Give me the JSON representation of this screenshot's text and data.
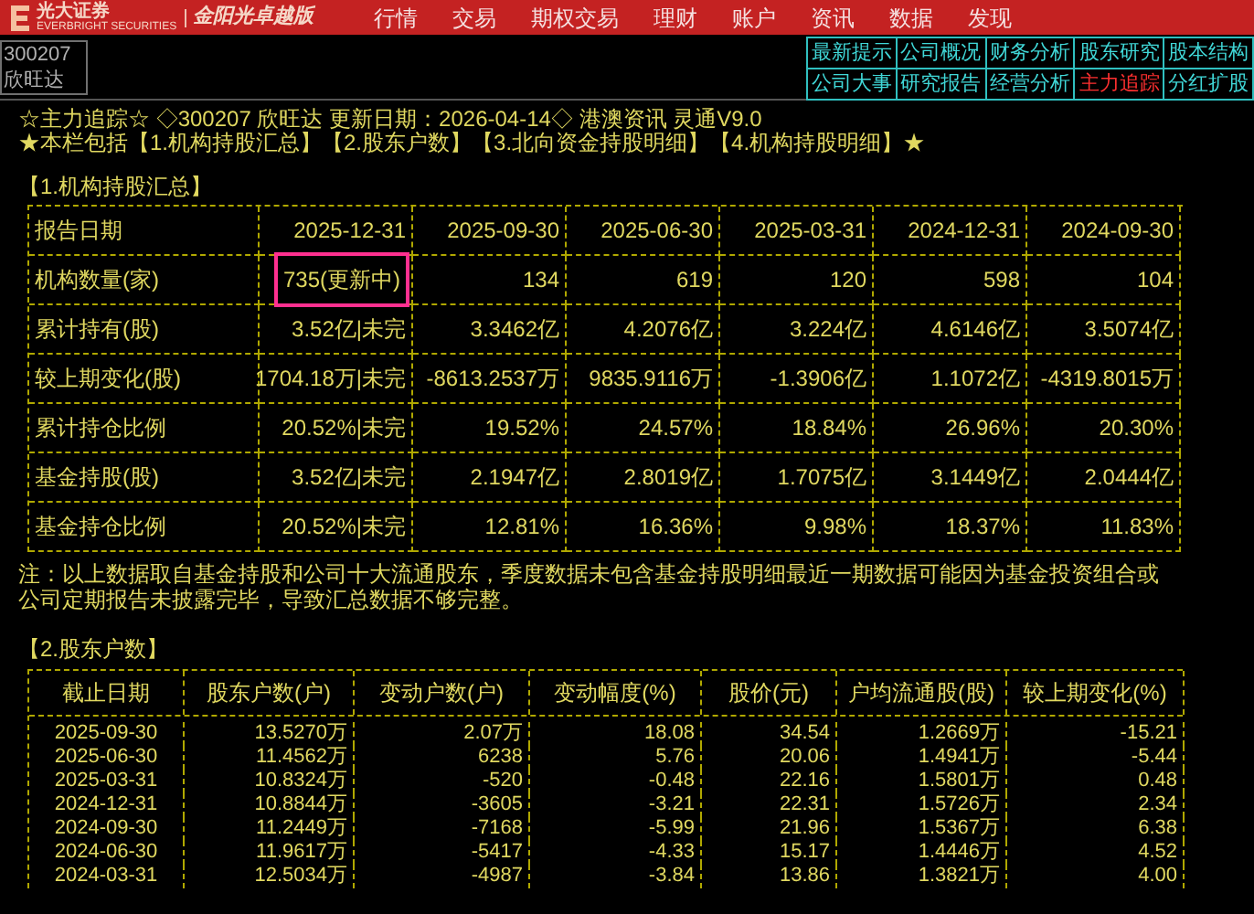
{
  "header": {
    "brand": "光大证券",
    "brand_en": "EVERBRIGHT SECURITIES",
    "edition": "金阳光卓越版",
    "menu": [
      "行情",
      "交易",
      "期权交易",
      "理财",
      "账户",
      "资讯",
      "数据",
      "发现"
    ]
  },
  "stock_box": {
    "code": "300207",
    "name": "欣旺达"
  },
  "tabs": [
    {
      "label": "最新提示",
      "selected": false
    },
    {
      "label": "公司概况",
      "selected": false
    },
    {
      "label": "财务分析",
      "selected": false
    },
    {
      "label": "股东研究",
      "selected": false
    },
    {
      "label": "股本结构",
      "selected": false
    },
    {
      "label": "公司大事",
      "selected": false
    },
    {
      "label": "研究报告",
      "selected": false
    },
    {
      "label": "经营分析",
      "selected": false
    },
    {
      "label": "主力追踪",
      "selected": true
    },
    {
      "label": "分红扩股",
      "selected": false
    }
  ],
  "intro": [
    "☆主力追踪☆ ◇300207 欣旺达 更新日期：2026-04-14◇ 港澳资讯 灵通V9.0",
    "★本栏包括【1.机构持股汇总】【2.股东户数】【3.北向资金持股明细】【4.机构持股明细】★"
  ],
  "section1": {
    "title": "【1.机构持股汇总】",
    "row_header": "报告日期",
    "columns": [
      "2025-12-31",
      "2025-09-30",
      "2025-06-30",
      "2025-03-31",
      "2024-12-31",
      "2024-09-30"
    ],
    "rows": [
      {
        "label": "机构数量(家)",
        "cells": [
          {
            "text": "735(更新中)",
            "highlighted": true
          },
          {
            "text": "134",
            "highlighted": false
          },
          {
            "text": "619",
            "highlighted": false
          },
          {
            "text": "120",
            "highlighted": false
          },
          {
            "text": "598",
            "highlighted": false
          },
          {
            "text": "104",
            "highlighted": false
          }
        ]
      },
      {
        "label": "累计持有(股)",
        "cells": [
          {
            "text": "3.52亿|未完",
            "highlighted": false
          },
          {
            "text": "3.3462亿",
            "highlighted": false
          },
          {
            "text": "4.2076亿",
            "highlighted": false
          },
          {
            "text": "3.224亿",
            "highlighted": false
          },
          {
            "text": "4.6146亿",
            "highlighted": false
          },
          {
            "text": "3.5074亿",
            "highlighted": false
          }
        ]
      },
      {
        "label": "较上期变化(股)",
        "cells": [
          {
            "text": "1704.18万|未完",
            "highlighted": false
          },
          {
            "text": "-8613.2537万",
            "highlighted": false
          },
          {
            "text": "9835.9116万",
            "highlighted": false
          },
          {
            "text": "-1.3906亿",
            "highlighted": false
          },
          {
            "text": "1.1072亿",
            "highlighted": false
          },
          {
            "text": "-4319.8015万",
            "highlighted": false
          }
        ]
      },
      {
        "label": "累计持仓比例",
        "cells": [
          {
            "text": "20.52%|未完",
            "highlighted": false
          },
          {
            "text": "19.52%",
            "highlighted": false
          },
          {
            "text": "24.57%",
            "highlighted": false
          },
          {
            "text": "18.84%",
            "highlighted": false
          },
          {
            "text": "26.96%",
            "highlighted": false
          },
          {
            "text": "20.30%",
            "highlighted": false
          }
        ]
      },
      {
        "label": "基金持股(股)",
        "cells": [
          {
            "text": "3.52亿|未完",
            "highlighted": false
          },
          {
            "text": "2.1947亿",
            "highlighted": false
          },
          {
            "text": "2.8019亿",
            "highlighted": false
          },
          {
            "text": "1.7075亿",
            "highlighted": false
          },
          {
            "text": "3.1449亿",
            "highlighted": false
          },
          {
            "text": "2.0444亿",
            "highlighted": false
          }
        ]
      },
      {
        "label": "基金持仓比例",
        "cells": [
          {
            "text": "20.52%|未完",
            "highlighted": false
          },
          {
            "text": "12.81%",
            "highlighted": false
          },
          {
            "text": "16.36%",
            "highlighted": false
          },
          {
            "text": "9.98%",
            "highlighted": false
          },
          {
            "text": "18.37%",
            "highlighted": false
          },
          {
            "text": "11.83%",
            "highlighted": false
          }
        ]
      }
    ],
    "note": "注：以上数据取自基金持股和公司十大流通股东，季度数据未包含基金持股明细最近一期数据可能因为基金投资组合或公司定期报告未披露完毕，导致汇总数据不够完整。"
  },
  "section2": {
    "title": "【2.股东户数】",
    "columns": [
      "截止日期",
      "股东户数(户)",
      "变动户数(户)",
      "变动幅度(%)",
      "股价(元)",
      "户均流通股(股)",
      "较上期变化(%)"
    ],
    "rows": [
      [
        "2025-09-30",
        "13.5270万",
        "2.07万",
        "18.08",
        "34.54",
        "1.2669万",
        "-15.21"
      ],
      [
        "2025-06-30",
        "11.4562万",
        "6238",
        "5.76",
        "20.06",
        "1.4941万",
        "-5.44"
      ],
      [
        "2025-03-31",
        "10.8324万",
        "-520",
        "-0.48",
        "22.16",
        "1.5801万",
        "0.48"
      ],
      [
        "2024-12-31",
        "10.8844万",
        "-3605",
        "-3.21",
        "22.31",
        "1.5726万",
        "2.34"
      ],
      [
        "2024-09-30",
        "11.2449万",
        "-7168",
        "-5.99",
        "21.96",
        "1.5367万",
        "6.38"
      ],
      [
        "2024-06-30",
        "11.9617万",
        "-5417",
        "-4.33",
        "15.17",
        "1.4446万",
        "4.52"
      ],
      [
        "2024-03-31",
        "12.5034万",
        "-4987",
        "-3.84",
        "13.86",
        "1.3821万",
        "4.00"
      ]
    ]
  }
}
